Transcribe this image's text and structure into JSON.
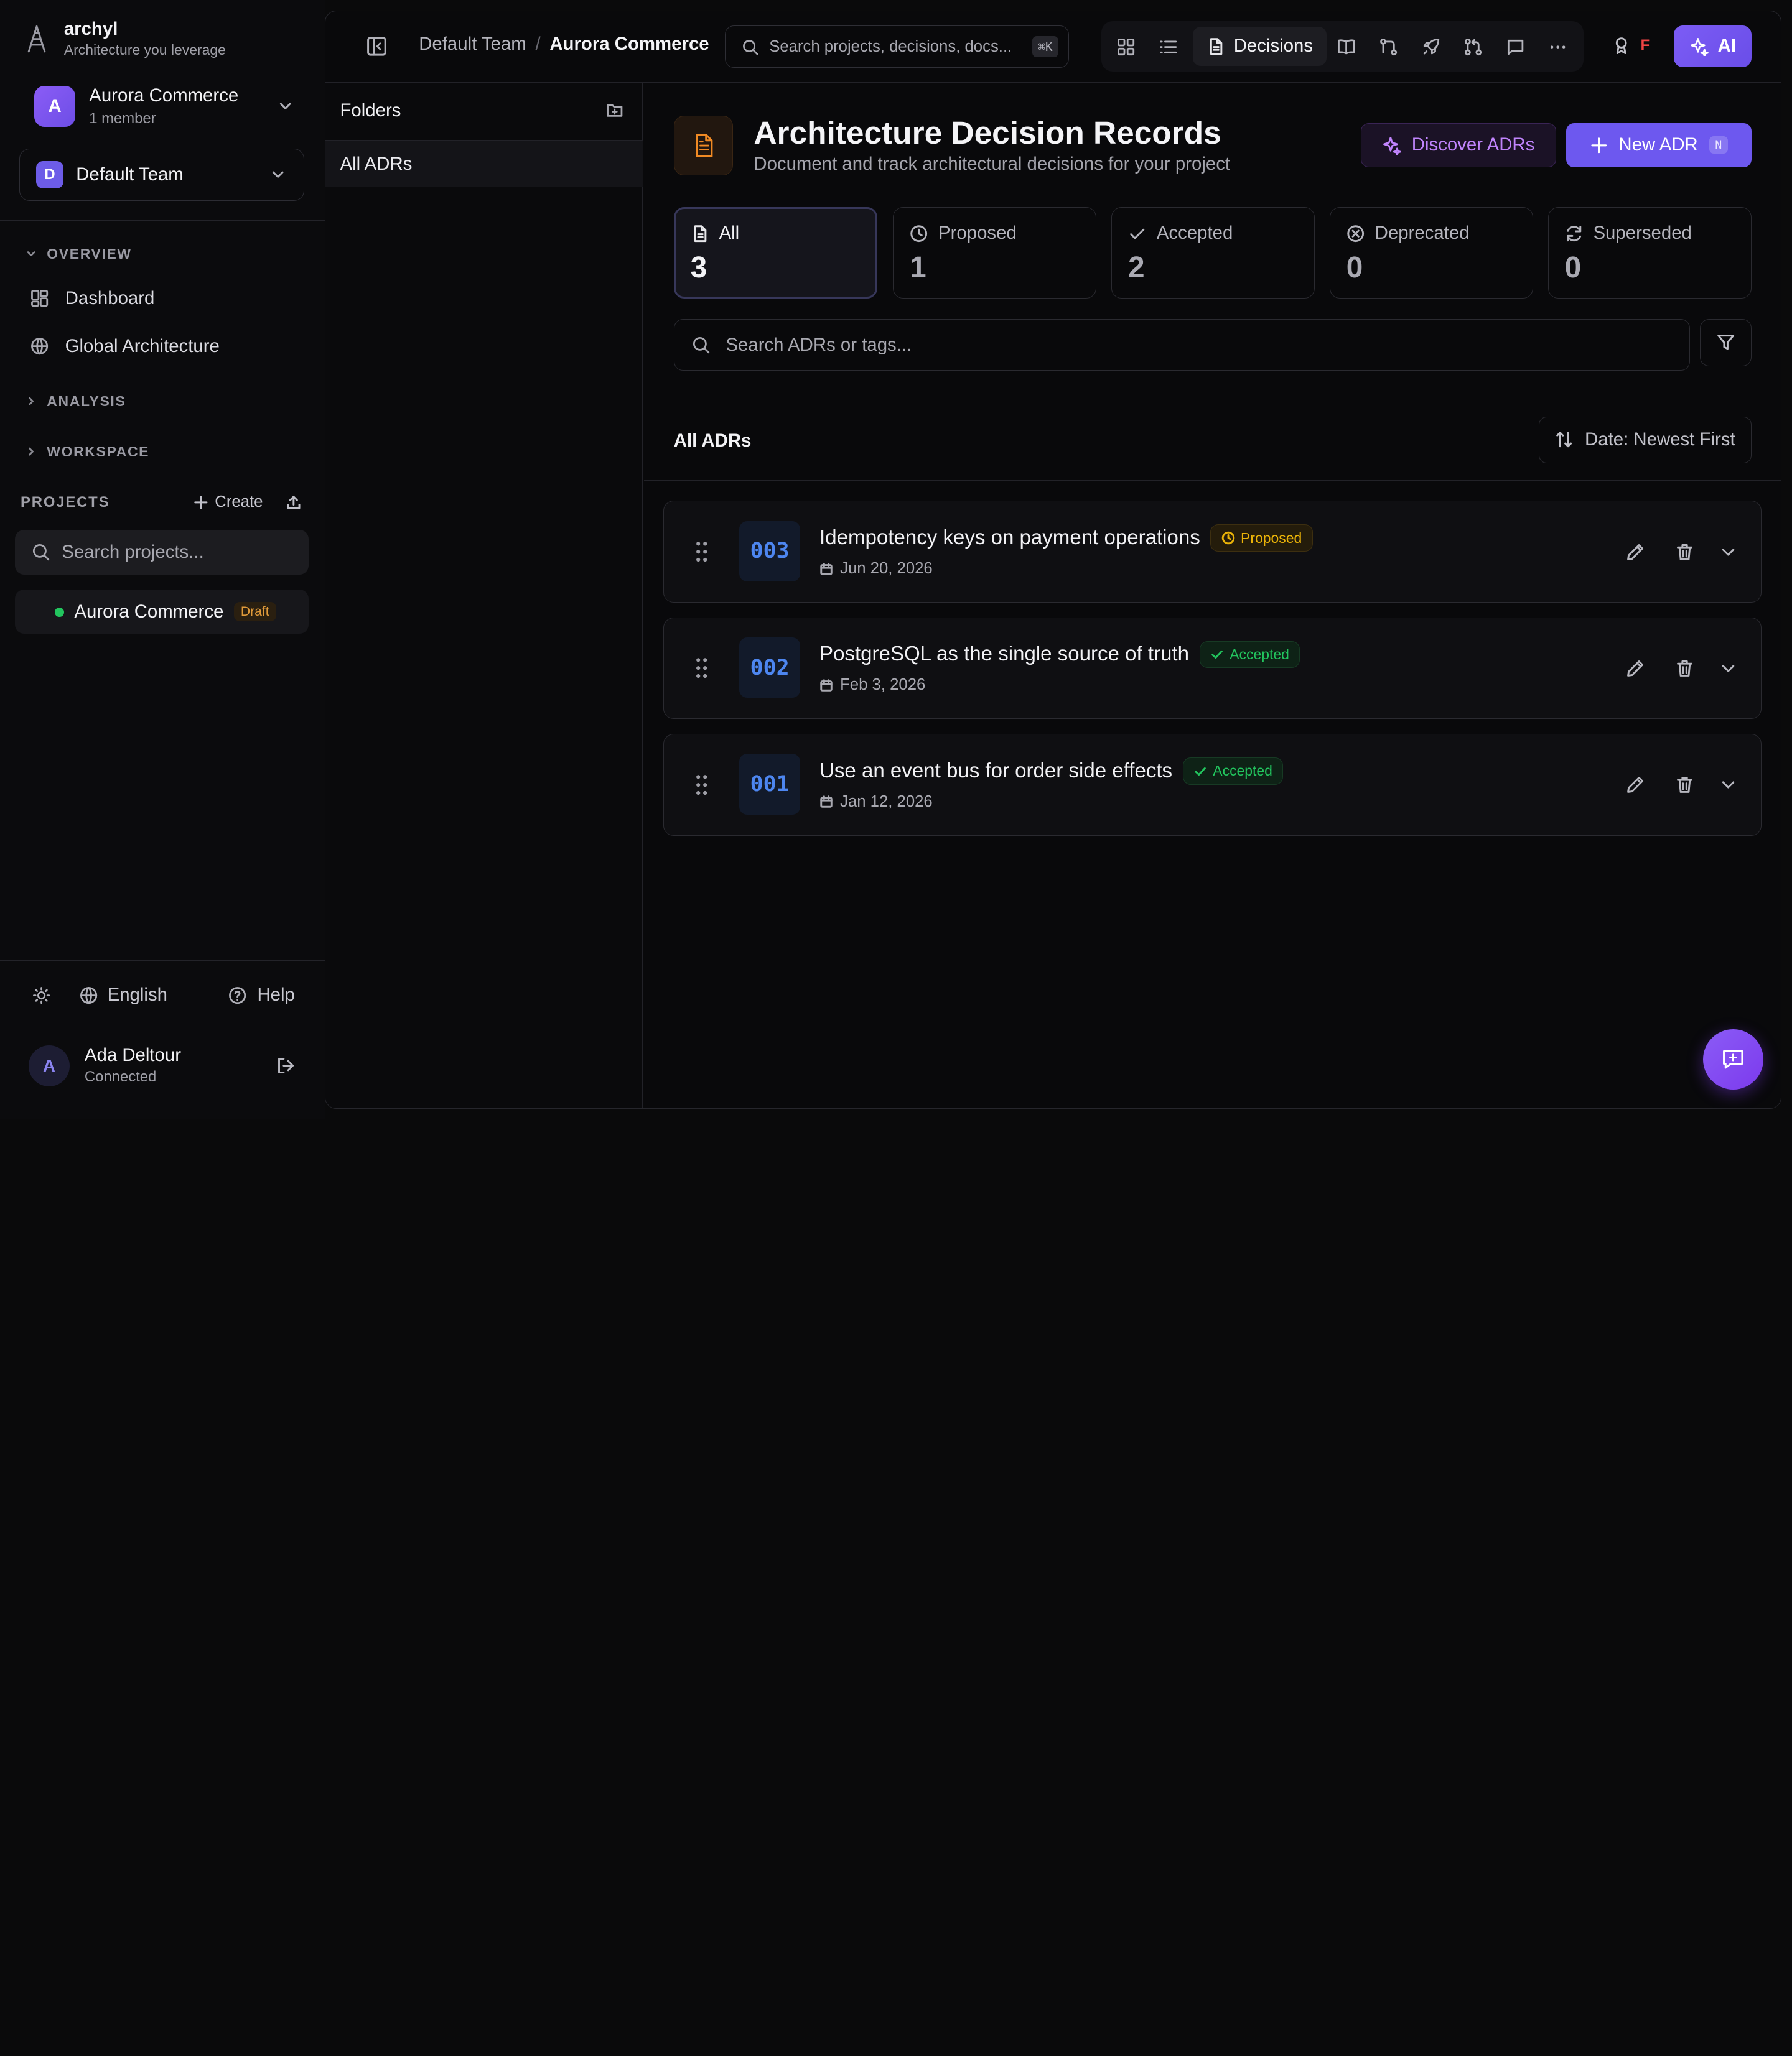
{
  "sidebar": {
    "brand": {
      "name": "archyl",
      "tagline": "Architecture you leverage"
    },
    "project_switcher": {
      "initial": "A",
      "name": "Aurora Commerce",
      "members": "1 member"
    },
    "team_select": {
      "initial": "D",
      "name": "Default Team"
    },
    "sections": {
      "overview": "OVERVIEW",
      "analysis": "ANALYSIS",
      "workspace": "WORKSPACE"
    },
    "nav": {
      "dashboard": "Dashboard",
      "global_architecture": "Global Architecture"
    },
    "projects": {
      "label": "PROJECTS",
      "create_label": "Create",
      "search_placeholder": "Search projects...",
      "items": [
        {
          "name": "Aurora Commerce",
          "badge": "Draft",
          "status_color": "#22c55e"
        }
      ]
    },
    "footer": {
      "language": "English",
      "help": "Help"
    },
    "user": {
      "initial": "A",
      "name": "Ada Deltour",
      "status": "Connected"
    }
  },
  "topbar": {
    "breadcrumb": {
      "team": "Default Team",
      "separator": "/",
      "project": "Aurora Commerce"
    },
    "search": {
      "placeholder": "Search projects, decisions, docs...",
      "shortcut": "⌘K"
    },
    "active_tool": "Decisions",
    "award_badge": "F",
    "ai_label": "AI"
  },
  "folders": {
    "title": "Folders",
    "items": [
      {
        "label": "All ADRs"
      }
    ]
  },
  "main": {
    "title": "Architecture Decision Records",
    "subtitle": "Document and track architectural decisions for your project",
    "discover_label": "Discover ADRs",
    "new_label": "New ADR",
    "new_shortcut": "N",
    "stats": [
      {
        "label": "All",
        "value": "3"
      },
      {
        "label": "Proposed",
        "value": "1"
      },
      {
        "label": "Accepted",
        "value": "2"
      },
      {
        "label": "Deprecated",
        "value": "0"
      },
      {
        "label": "Superseded",
        "value": "0"
      }
    ],
    "search_placeholder": "Search ADRs or tags...",
    "list_title": "All ADRs",
    "sort_label": "Date: Newest First",
    "adrs": [
      {
        "number": "003",
        "title": "Idempotency keys on payment operations",
        "status": "Proposed",
        "date": "Jun 20, 2026"
      },
      {
        "number": "002",
        "title": "PostgreSQL as the single source of truth",
        "status": "Accepted",
        "date": "Feb 3, 2026"
      },
      {
        "number": "001",
        "title": "Use an event bus for order side effects",
        "status": "Accepted",
        "date": "Jan 12, 2026"
      }
    ]
  },
  "colors": {
    "accent": "#6d58ef",
    "proposed": "#eab308",
    "accepted": "#22c55e",
    "adr_number": "#4d86f0",
    "page_icon": "#f08a24"
  }
}
